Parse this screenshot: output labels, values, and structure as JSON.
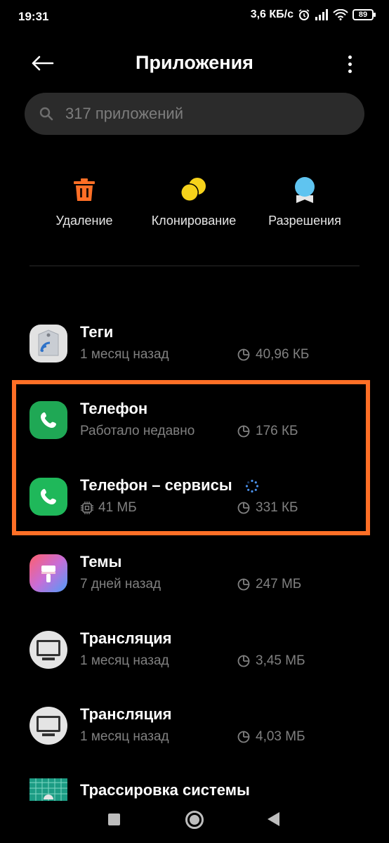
{
  "status_bar": {
    "time": "19:31",
    "network_speed": "3,6 КБ/с",
    "battery": "89",
    "icons": [
      "alarm-icon",
      "signal-icon",
      "wifi-icon",
      "battery-icon"
    ]
  },
  "header": {
    "title": "Приложения",
    "back_icon": "arrow-left-icon",
    "more_icon": "more-vert-icon"
  },
  "search": {
    "placeholder": "317 приложений",
    "value": ""
  },
  "actions": [
    {
      "label": "Удаление",
      "icon": "trash-icon",
      "color": "#ff6f26"
    },
    {
      "label": "Клонирование",
      "icon": "clone-icon",
      "color": "#f6d21b"
    },
    {
      "label": "Разрешения",
      "icon": "permissions-icon",
      "color": "#5fc4f0"
    }
  ],
  "apps": [
    {
      "name": "Теги",
      "subtitle": "1 месяц назад",
      "size": "40,96 КБ",
      "icon": "tag-icon"
    },
    {
      "name": "Телефон",
      "subtitle": "Работало недавно",
      "size": "176 КБ",
      "icon": "phone-icon"
    },
    {
      "name": "Телефон – сервисы",
      "subtitle": "41 МБ",
      "size": "331 КБ",
      "icon": "phone-icon"
    },
    {
      "name": "Темы",
      "subtitle": "7 дней назад",
      "size": "247 МБ",
      "icon": "themes-icon"
    },
    {
      "name": "Трансляция",
      "subtitle": "1 месяц назад",
      "size": "3,45 МБ",
      "icon": "monitor-icon"
    },
    {
      "name": "Трансляция",
      "subtitle": "1 месяц назад",
      "size": "4,03 МБ",
      "icon": "monitor-icon"
    },
    {
      "name": "Трассировка системы",
      "subtitle": "",
      "size": "",
      "icon": "trace-icon"
    }
  ],
  "colors": {
    "background": "#000000",
    "search_bg": "#2b2b2b",
    "highlight": "#ff6f26",
    "secondary_text": "#808080",
    "phone_green": "#1fa855"
  }
}
